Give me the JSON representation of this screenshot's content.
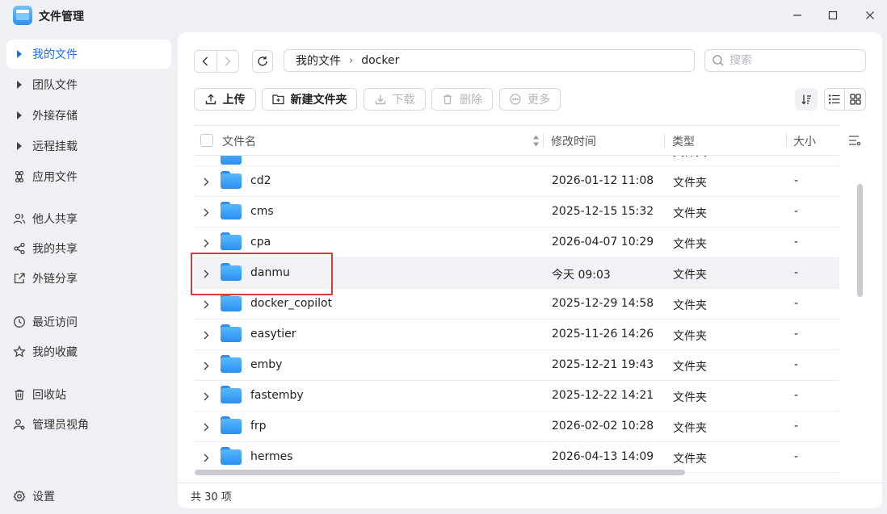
{
  "app": {
    "title": "文件管理"
  },
  "sidebar": {
    "items": [
      {
        "label": "我的文件",
        "icon": "caret-right-icon"
      },
      {
        "label": "团队文件",
        "icon": "caret-right-icon"
      },
      {
        "label": "外接存储",
        "icon": "caret-right-icon"
      },
      {
        "label": "远程挂载",
        "icon": "caret-right-icon"
      },
      {
        "label": "应用文件",
        "icon": "command-icon"
      },
      {
        "label": "他人共享",
        "icon": "users-icon"
      },
      {
        "label": "我的共享",
        "icon": "share-icon"
      },
      {
        "label": "外链分享",
        "icon": "external-link-icon"
      },
      {
        "label": "最近访问",
        "icon": "clock-icon"
      },
      {
        "label": "我的收藏",
        "icon": "star-icon"
      },
      {
        "label": "回收站",
        "icon": "trash-icon"
      },
      {
        "label": "管理员视角",
        "icon": "admin-icon"
      },
      {
        "label": "设置",
        "icon": "gear-icon"
      }
    ]
  },
  "breadcrumb": {
    "root": "我的文件",
    "current": "docker"
  },
  "search": {
    "placeholder": "搜索"
  },
  "toolbar": {
    "upload": "上传",
    "new_folder": "新建文件夹",
    "download": "下载",
    "delete": "删除",
    "more": "更多"
  },
  "table": {
    "headers": {
      "name": "文件名",
      "modified": "修改时间",
      "type": "类型",
      "size": "大小"
    },
    "rows": [
      {
        "name": "cd2",
        "modified": "2026-01-12 11:08",
        "type": "文件夹",
        "size": "-"
      },
      {
        "name": "cms",
        "modified": "2025-12-15 15:32",
        "type": "文件夹",
        "size": "-"
      },
      {
        "name": "cpa",
        "modified": "2026-04-07 10:29",
        "type": "文件夹",
        "size": "-"
      },
      {
        "name": "danmu",
        "modified": "今天 09:03",
        "type": "文件夹",
        "size": "-"
      },
      {
        "name": "docker_copilot",
        "modified": "2025-12-29 14:58",
        "type": "文件夹",
        "size": "-"
      },
      {
        "name": "easytier",
        "modified": "2025-11-26 14:26",
        "type": "文件夹",
        "size": "-"
      },
      {
        "name": "emby",
        "modified": "2025-12-21 19:43",
        "type": "文件夹",
        "size": "-"
      },
      {
        "name": "fastemby",
        "modified": "2025-12-22 14:21",
        "type": "文件夹",
        "size": "-"
      },
      {
        "name": "frp",
        "modified": "2026-02-02 10:28",
        "type": "文件夹",
        "size": "-"
      },
      {
        "name": "hermes",
        "modified": "2026-04-13 14:09",
        "type": "文件夹",
        "size": "-"
      }
    ],
    "partial_row_type": "文件夹"
  },
  "status": {
    "count": "共 30 项"
  },
  "colors": {
    "accent": "#1a6fe8",
    "highlight_border": "#d93b3b",
    "selected_row": "#f1f2f5"
  }
}
